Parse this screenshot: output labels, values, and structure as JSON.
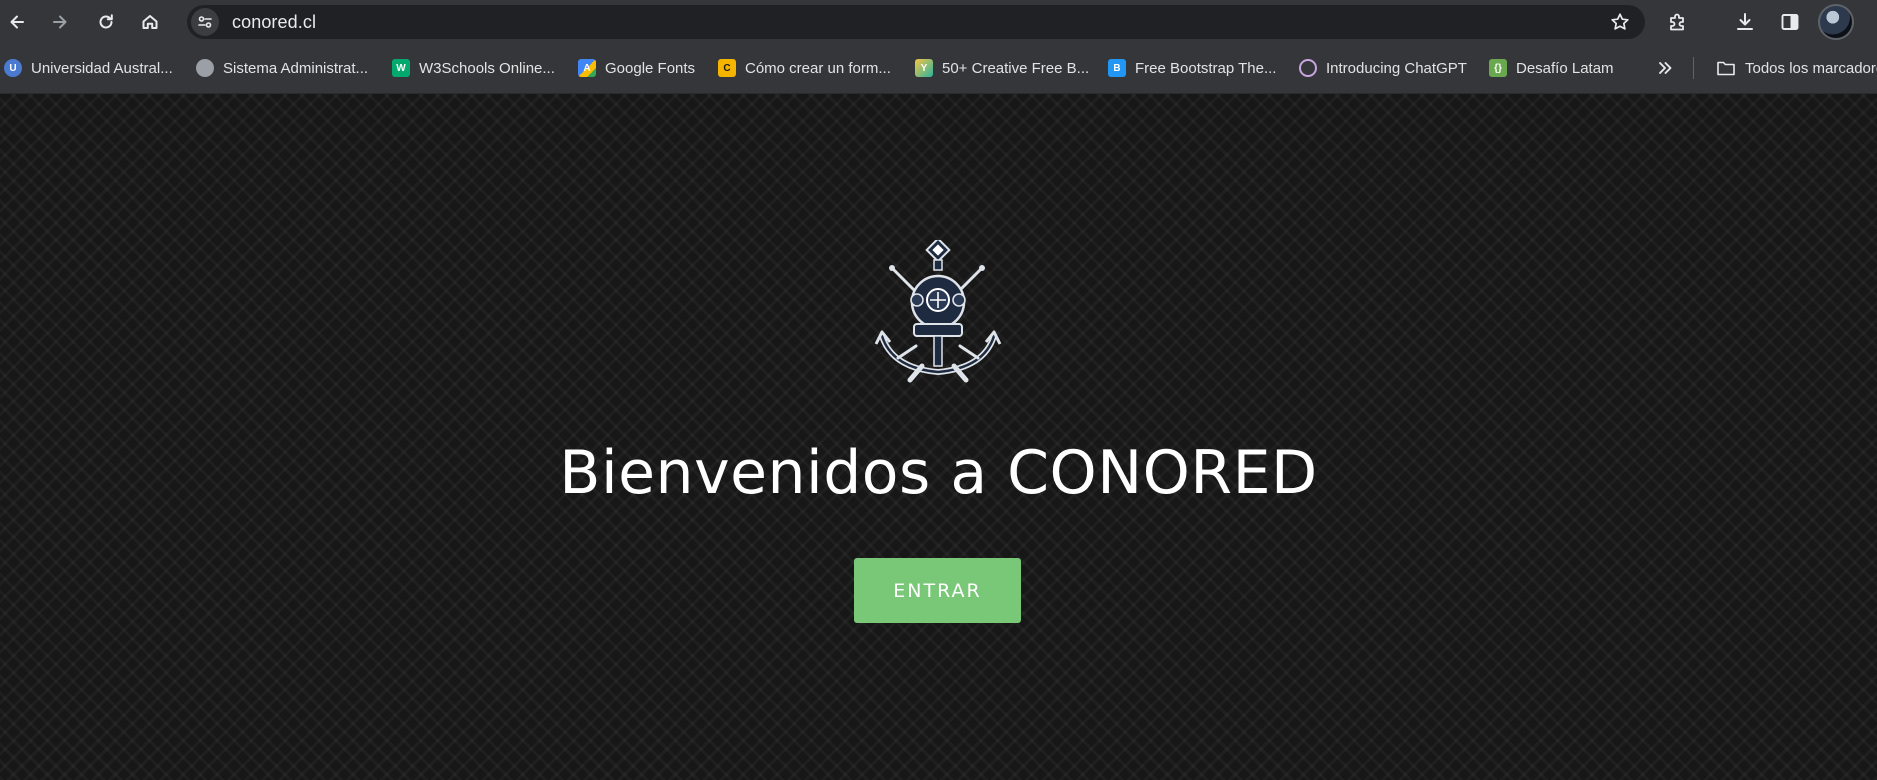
{
  "browser": {
    "url": "conored.cl",
    "nav": {
      "back": "back-arrow-icon",
      "forward": "forward-arrow-icon",
      "reload": "reload-icon",
      "home": "home-icon"
    },
    "bookmarks": [
      {
        "label": "Universidad Austral...",
        "icon": "globe-blue-icon",
        "color": "#4a7bd0"
      },
      {
        "label": "Sistema Administrat...",
        "icon": "globe-icon",
        "color": "#9aa0a6"
      },
      {
        "label": "W3Schools Online...",
        "icon": "w3schools-icon",
        "color": "#04aa6d"
      },
      {
        "label": "Google Fonts",
        "icon": "google-fonts-icon",
        "color": "#4285f4"
      },
      {
        "label": "Cómo crear un form...",
        "icon": "site-icon",
        "color": "#f4b400"
      },
      {
        "label": "50+ Creative Free B...",
        "icon": "bird-icon",
        "color": "#2bb3a0"
      },
      {
        "label": "Free Bootstrap The...",
        "icon": "bootstrap-icon",
        "color": "#2196f3"
      },
      {
        "label": "Introducing ChatGPT",
        "icon": "chatgpt-icon",
        "color": "#c7a6e0"
      },
      {
        "label": "Desafío Latam",
        "icon": "desafio-latam-icon",
        "color": "#6aa84f"
      }
    ],
    "more_bookmarks_icon": "chevron-double-right-icon",
    "all_bookmarks": {
      "label": "Todos los marcadores",
      "icon": "folder-icon"
    }
  },
  "page": {
    "headline": "Bienvenidos a CONORED",
    "enter_label": "ENTRAR",
    "logo_icon": "diver-helmet-anchor-logo",
    "colors": {
      "background": "#171717",
      "button": "#79c878",
      "text": "#ffffff"
    }
  }
}
